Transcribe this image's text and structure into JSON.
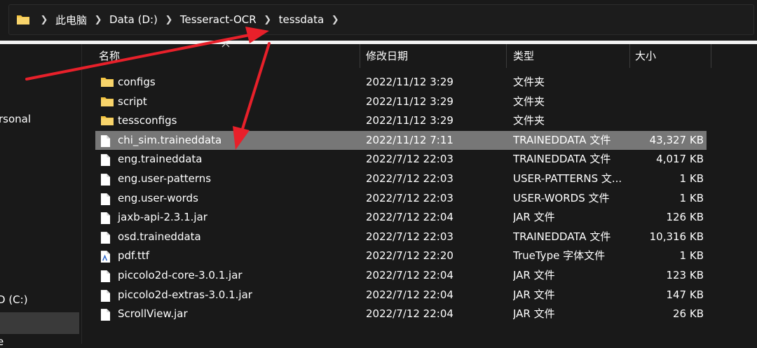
{
  "address_bar": {
    "crumbs": [
      "此电脑",
      "Data (D:)",
      "Tesseract-OCR",
      "tessdata"
    ]
  },
  "nav_pane": {
    "items": [
      "rsonal",
      "D (C:)",
      "e"
    ]
  },
  "columns": {
    "name": "名称",
    "date": "修改日期",
    "type": "类型",
    "size": "大小"
  },
  "files": [
    {
      "name": "configs",
      "date": "2022/11/12 3:29",
      "type": "文件夹",
      "size": "",
      "icon": "folder-icon"
    },
    {
      "name": "script",
      "date": "2022/11/12 3:29",
      "type": "文件夹",
      "size": "",
      "icon": "folder-icon"
    },
    {
      "name": "tessconfigs",
      "date": "2022/11/12 3:29",
      "type": "文件夹",
      "size": "",
      "icon": "folder-icon"
    },
    {
      "name": "chi_sim.traineddata",
      "date": "2022/11/12 7:11",
      "type": "TRAINEDDATA 文件",
      "size": "43,327 KB",
      "icon": "file-icon",
      "selected": true
    },
    {
      "name": "eng.traineddata",
      "date": "2022/7/12 22:03",
      "type": "TRAINEDDATA 文件",
      "size": "4,017 KB",
      "icon": "file-icon"
    },
    {
      "name": "eng.user-patterns",
      "date": "2022/7/12 22:03",
      "type": "USER-PATTERNS 文...",
      "size": "1 KB",
      "icon": "file-icon"
    },
    {
      "name": "eng.user-words",
      "date": "2022/7/12 22:03",
      "type": "USER-WORDS 文件",
      "size": "1 KB",
      "icon": "file-icon"
    },
    {
      "name": "jaxb-api-2.3.1.jar",
      "date": "2022/7/12 22:04",
      "type": "JAR 文件",
      "size": "126 KB",
      "icon": "file-icon"
    },
    {
      "name": "osd.traineddata",
      "date": "2022/7/12 22:03",
      "type": "TRAINEDDATA 文件",
      "size": "10,316 KB",
      "icon": "file-icon"
    },
    {
      "name": "pdf.ttf",
      "date": "2022/7/12 22:20",
      "type": "TrueType 字体文件",
      "size": "1 KB",
      "icon": "font-file-icon"
    },
    {
      "name": "piccolo2d-core-3.0.1.jar",
      "date": "2022/7/12 22:04",
      "type": "JAR 文件",
      "size": "123 KB",
      "icon": "file-icon"
    },
    {
      "name": "piccolo2d-extras-3.0.1.jar",
      "date": "2022/7/12 22:04",
      "type": "JAR 文件",
      "size": "147 KB",
      "icon": "file-icon"
    },
    {
      "name": "ScrollView.jar",
      "date": "2022/7/12 22:04",
      "type": "JAR 文件",
      "size": "26 KB",
      "icon": "file-icon"
    }
  ],
  "colors": {
    "background": "#191919",
    "selected_row": "#777777",
    "folder": "#f4c542",
    "annotation_arrow": "#e8202a"
  }
}
